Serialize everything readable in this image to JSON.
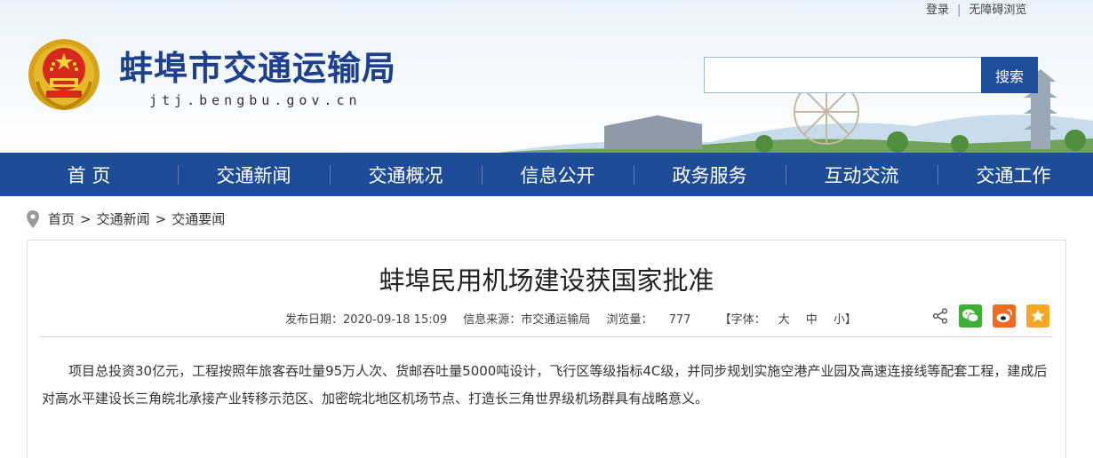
{
  "top_links": {
    "login": "登录",
    "separator": "|",
    "accessibility": "无障碍浏览"
  },
  "site": {
    "title": "蚌埠市交通运输局",
    "url": "jtj.bengbu.gov.cn"
  },
  "search": {
    "placeholder": "",
    "button_label": "搜索"
  },
  "nav": {
    "items": [
      "首 页",
      "交通新闻",
      "交通概况",
      "信息公开",
      "政务服务",
      "互动交流",
      "交通工作"
    ]
  },
  "breadcrumb": {
    "home": "首页",
    "level1": "交通新闻",
    "level2": "交通要闻",
    "separator": ">"
  },
  "article": {
    "title": "蚌埠民用机场建设获国家批准",
    "publish_date": "发布日期：2020-09-18 15:09",
    "source": "信息来源：市交通运输局",
    "views_label": "浏览量：",
    "views": "777",
    "font_size_label": "【字体：",
    "font_large": "大",
    "font_medium": "中",
    "font_small": "小】",
    "body": "项目总投资30亿元，工程按照年旅客吞吐量95万人次、货邮吞吐量5000吨设计，飞行区等级指标4C级，并同步规划实施空港产业园及高速连接线等配套工程，建成后对高水平建设长三角皖北承接产业转移示范区、加密皖北地区机场节点、打造长三角世界级机场群具有战略意义。"
  },
  "share_icons": [
    "share-icon",
    "wechat-icon",
    "weibo-icon",
    "favorite-star-icon"
  ],
  "colors": {
    "brand_blue": "#1f4c97",
    "title_blue": "#1d3f8c",
    "wechat_green": "#3cb034",
    "weibo_orange": "#f06a22",
    "star_orange": "#f5a623"
  }
}
